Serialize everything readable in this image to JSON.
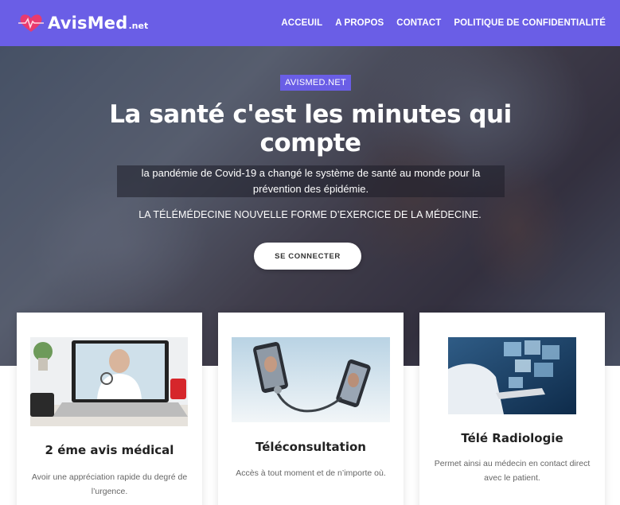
{
  "brand": {
    "name": "AvisMed",
    "suffix": ".net"
  },
  "nav": {
    "items": [
      {
        "label": "ACCEUIL"
      },
      {
        "label": "A PROPOS"
      },
      {
        "label": "CONTACT"
      },
      {
        "label": "POLITIQUE DE CONFIDENTIALITÉ"
      }
    ]
  },
  "hero": {
    "badge": "AVISMED.NET",
    "title": "La santé c'est les minutes qui compte",
    "description": "la pandémie de Covid-19 a changé le système de santé au monde pour la prévention des épidémie.",
    "subtitle": "LA TÉLÉMÉDECINE NOUVELLE FORME D’EXERCICE DE LA MÉDECINE.",
    "button_label": "SE CONNECTER"
  },
  "cards": [
    {
      "title": "2 éme avis médical",
      "description": "Avoir une appréciation rapide du degré de l’urgence."
    },
    {
      "title": "Téléconsultation",
      "description": "Accès à tout moment et de n’importe où."
    },
    {
      "title": "Télé Radiologie",
      "description": "Permet ainsi au médecin en contact direct avec le patient."
    }
  ],
  "colors": {
    "brand": "#6a5ee6",
    "heart": "#e83a6e"
  }
}
